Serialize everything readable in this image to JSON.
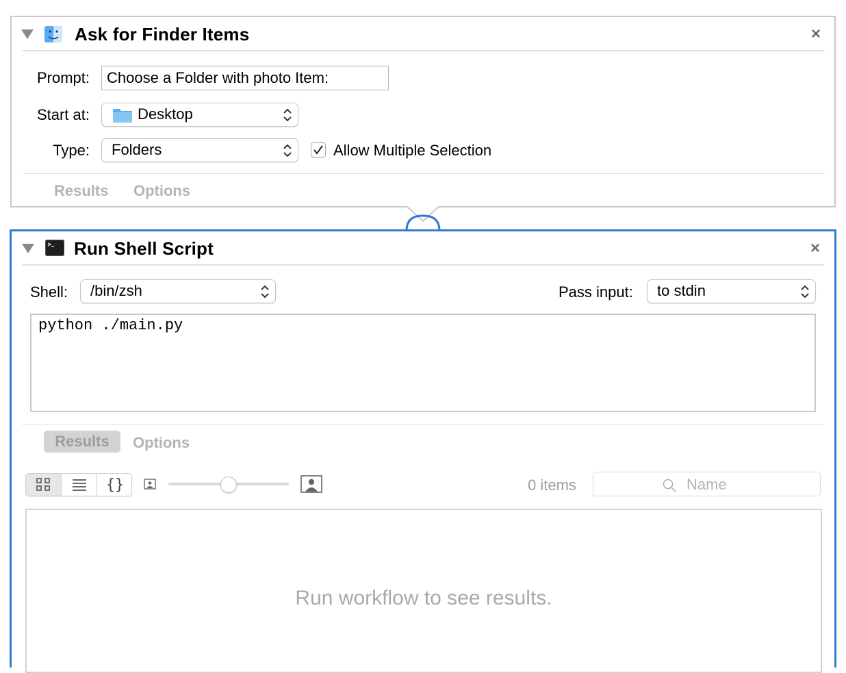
{
  "action1": {
    "title": "Ask for Finder Items",
    "prompt_label": "Prompt:",
    "prompt_value": "Choose a Folder with photo Item:",
    "start_label": "Start at:",
    "start_value": "Desktop",
    "type_label": "Type:",
    "type_value": "Folders",
    "multi_label": "Allow Multiple Selection",
    "multi_checked": true,
    "tabs": [
      "Results",
      "Options"
    ],
    "close": "×"
  },
  "action2": {
    "title": "Run Shell Script",
    "shell_label": "Shell:",
    "shell_value": "/bin/zsh",
    "pass_label": "Pass input:",
    "pass_value": "to stdin",
    "script": "python ./main.py",
    "tabs": [
      "Results",
      "Options"
    ],
    "selected_tab": "Results",
    "close": "×",
    "items_count": "0 items",
    "search_placeholder": "Name",
    "empty_message": "Run workflow to see results.",
    "view_icons": [
      "grid-view-icon",
      "list-view-icon",
      "braces-view-icon"
    ]
  },
  "colors": {
    "selected_border": "#2f78d3",
    "card_border": "#c8c8c8",
    "disabled_text": "#b4b4b4"
  }
}
